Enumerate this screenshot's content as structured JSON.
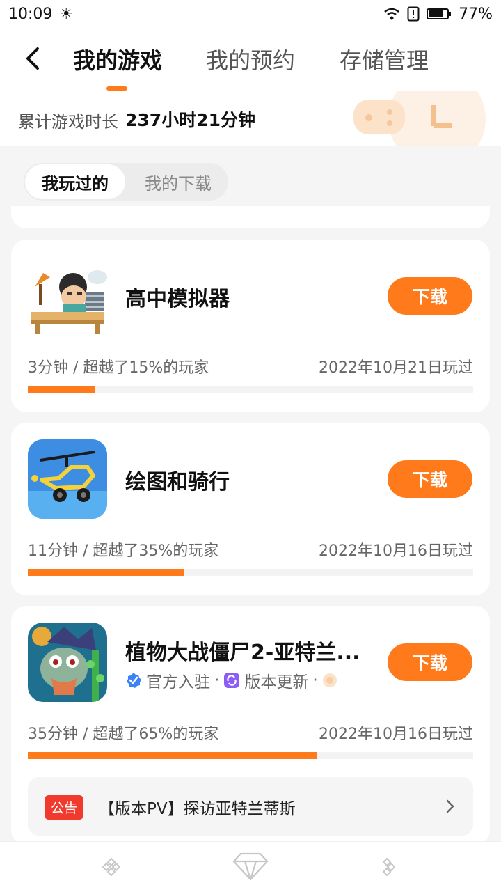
{
  "status_bar": {
    "time": "10:09",
    "battery": "77%"
  },
  "nav": {
    "tabs": [
      {
        "label": "我的游戏",
        "active": true
      },
      {
        "label": "我的预约",
        "active": false
      },
      {
        "label": "存储管理",
        "active": false
      }
    ]
  },
  "playtime": {
    "label": "累计游戏时长",
    "value": "237小时21分钟"
  },
  "filter": {
    "options": [
      "我玩过的",
      "我的下载"
    ],
    "selected": "我玩过的"
  },
  "games": [
    {
      "name": "高中模拟器",
      "button": "下载",
      "stat": "3分钟 / 超越了15%的玩家",
      "date": "2022年10月21日玩过",
      "progress": 0.15
    },
    {
      "name": "绘图和骑行",
      "button": "下载",
      "stat": "11分钟 / 超越了35%的玩家",
      "date": "2022年10月16日玩过",
      "progress": 0.35
    },
    {
      "name": "植物大战僵尸2-亚特兰...",
      "button": "下载",
      "tags": [
        "官方入驻",
        "版本更新"
      ],
      "stat": "35分钟 / 超越了65%的玩家",
      "date": "2022年10月16日玩过",
      "progress": 0.65,
      "notice": {
        "badge": "公告",
        "text": "【版本PV】探访亚特兰蒂斯"
      }
    }
  ],
  "colors": {
    "accent": "#ff7a1a",
    "badge": "#f03a2e",
    "verified": "#3b82f6",
    "update": "#8b5cf6"
  }
}
